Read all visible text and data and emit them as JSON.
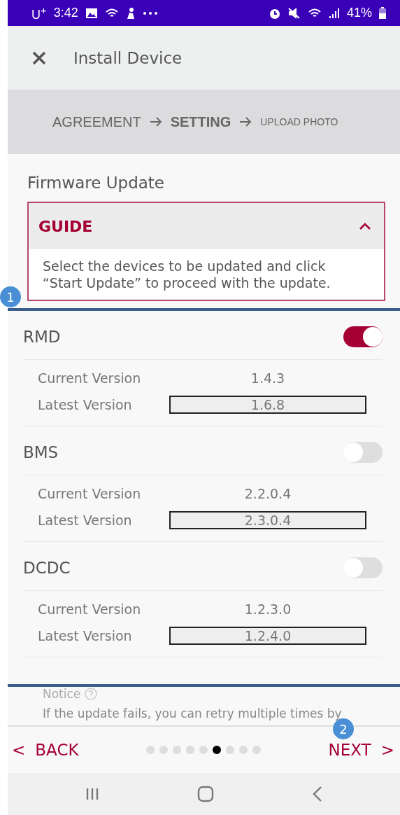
{
  "status_bar": {
    "carrier": "U$^{+}$",
    "time": "3:42",
    "battery": "41%"
  },
  "header": {
    "title": "Install Device"
  },
  "steps": [
    {
      "label": "AGREEMENT",
      "selected": false,
      "kind": "done"
    },
    {
      "label": "SETTING",
      "selected": true,
      "kind": "current"
    },
    {
      "label": "UPLOAD PHOTO",
      "selected": false,
      "kind": "next"
    }
  ],
  "section_title": "Firmware Update",
  "guide": {
    "title": "GUIDE",
    "expanded": true,
    "text": "Select the devices to be updated and click “Start Update” to proceed with the update."
  },
  "devices": [
    {
      "name": "RMD",
      "on": true,
      "current_label": "Current Version",
      "current": "1.4.3",
      "latest_label": "Latest Version",
      "latest": "1.6.8"
    },
    {
      "name": "BMS",
      "on": false,
      "current_label": "Current Version",
      "current": "2.2.0.4",
      "latest_label": "Latest Version",
      "latest": "2.3.0.4"
    },
    {
      "name": "DCDC",
      "on": false,
      "current_label": "Current Version",
      "current": "1.2.3.0",
      "latest_label": "Latest Version",
      "latest": "1.2.4.0"
    }
  ],
  "notice": {
    "title": "Notice",
    "text": "If the update fails, you can retry multiple times by"
  },
  "footer": {
    "back": "BACK",
    "next": "NEXT",
    "back_arrow": "<",
    "next_arrow": ">"
  },
  "pager": [
    {
      "selected": false
    },
    {
      "selected": false
    },
    {
      "selected": false
    },
    {
      "selected": false
    },
    {
      "selected": false
    },
    {
      "selected": true
    },
    {
      "selected": false
    },
    {
      "selected": false
    },
    {
      "selected": false
    }
  ],
  "annotations": [
    {
      "label": "1"
    },
    {
      "label": "2"
    }
  ]
}
